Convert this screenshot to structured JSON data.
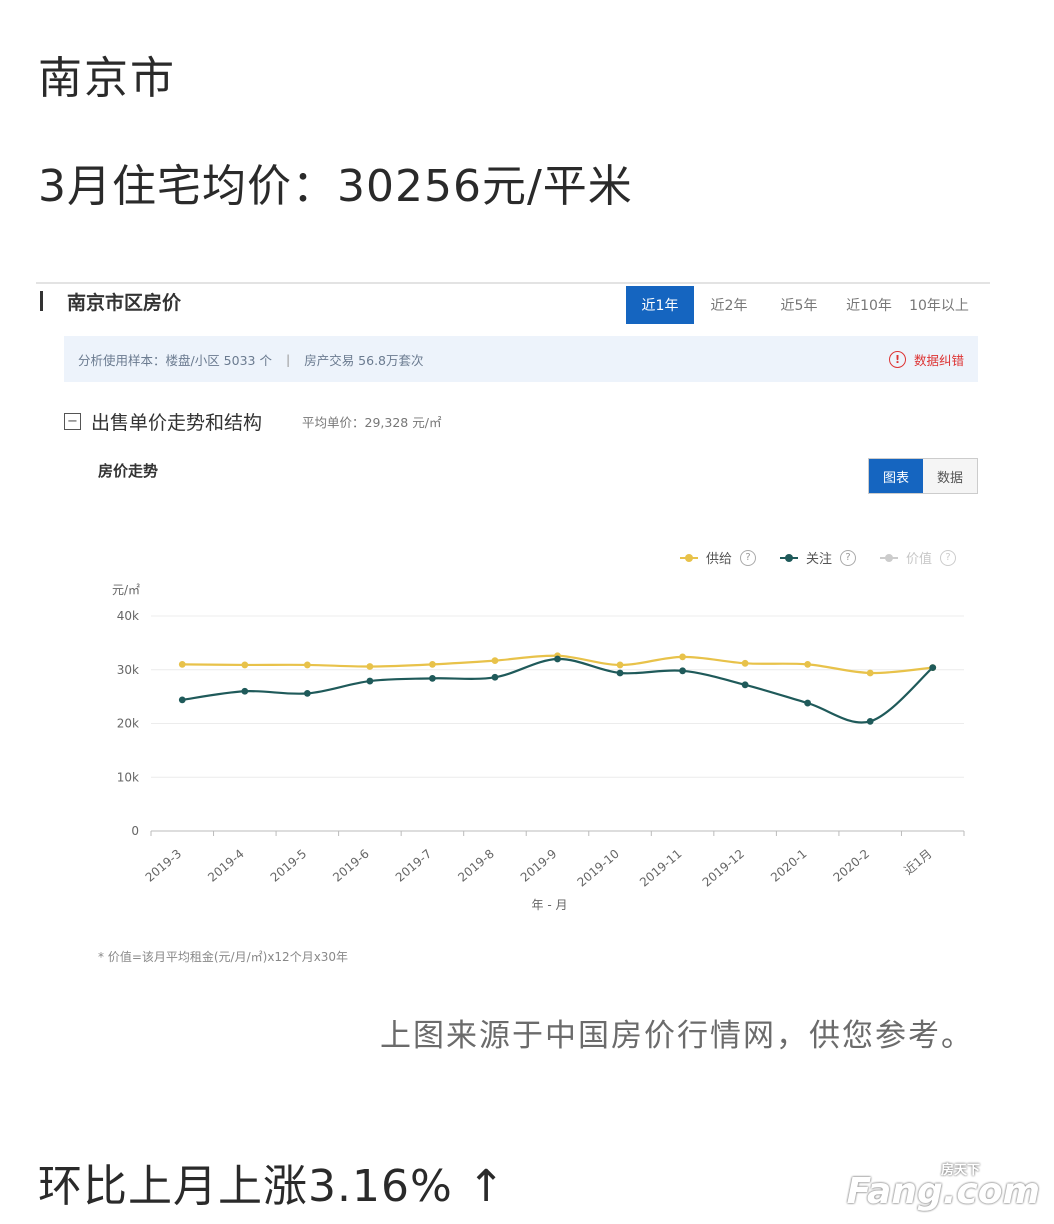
{
  "headline": {
    "city": "南京市",
    "avg_price": "3月住宅均价：30256元/平米",
    "mom": "环比上月上涨3.16% ↑",
    "source": "上图来源于中国房价行情网，供您参考。"
  },
  "panel": {
    "title": "南京市区房价",
    "tabs": [
      "近1年",
      "近2年",
      "近5年",
      "近10年",
      "10年以上"
    ],
    "active_tab": 0,
    "info": {
      "sample": "分析使用样本：楼盘/小区 5033 个",
      "trades": "房产交易 56.8万套次",
      "report": "数据纠错"
    },
    "section_title": "出售单价走势和结构",
    "section_avg": "平均单价：29,328 元/㎡",
    "chart_title": "房价走势",
    "toggle": [
      "图表",
      "数据"
    ],
    "footnote": "* 价值=该月平均租金(元/月/㎡)x12个月x30年"
  },
  "legend": [
    {
      "name": "供给",
      "color": "#e8c24a"
    },
    {
      "name": "关注",
      "color": "#1f5a5a"
    },
    {
      "name": "价值",
      "color": "#cccccc"
    }
  ],
  "chart_data": {
    "type": "line",
    "ylabel": "元/㎡",
    "xlabel": "年 - 月",
    "ylim": [
      0,
      40000
    ],
    "yticks": [
      "0",
      "10k",
      "20k",
      "30k",
      "40k"
    ],
    "categories": [
      "2019-3",
      "2019-4",
      "2019-5",
      "2019-6",
      "2019-7",
      "2019-8",
      "2019-9",
      "2019-10",
      "2019-11",
      "2019-12",
      "2020-1",
      "2020-2",
      "近1月"
    ],
    "series": [
      {
        "name": "供给",
        "color": "#e8c24a",
        "values": [
          31000,
          30900,
          30900,
          30600,
          31000,
          31700,
          32600,
          30900,
          32400,
          31200,
          31000,
          29400,
          30400
        ]
      },
      {
        "name": "关注",
        "color": "#1f5a5a",
        "values": [
          24400,
          26000,
          25600,
          27900,
          28400,
          28600,
          32000,
          29400,
          29800,
          27200,
          23800,
          20400,
          30400
        ]
      }
    ],
    "grid": true,
    "legend_position": "top-right"
  },
  "watermark": {
    "brand": "Fang.com",
    "cn": "房天下"
  }
}
